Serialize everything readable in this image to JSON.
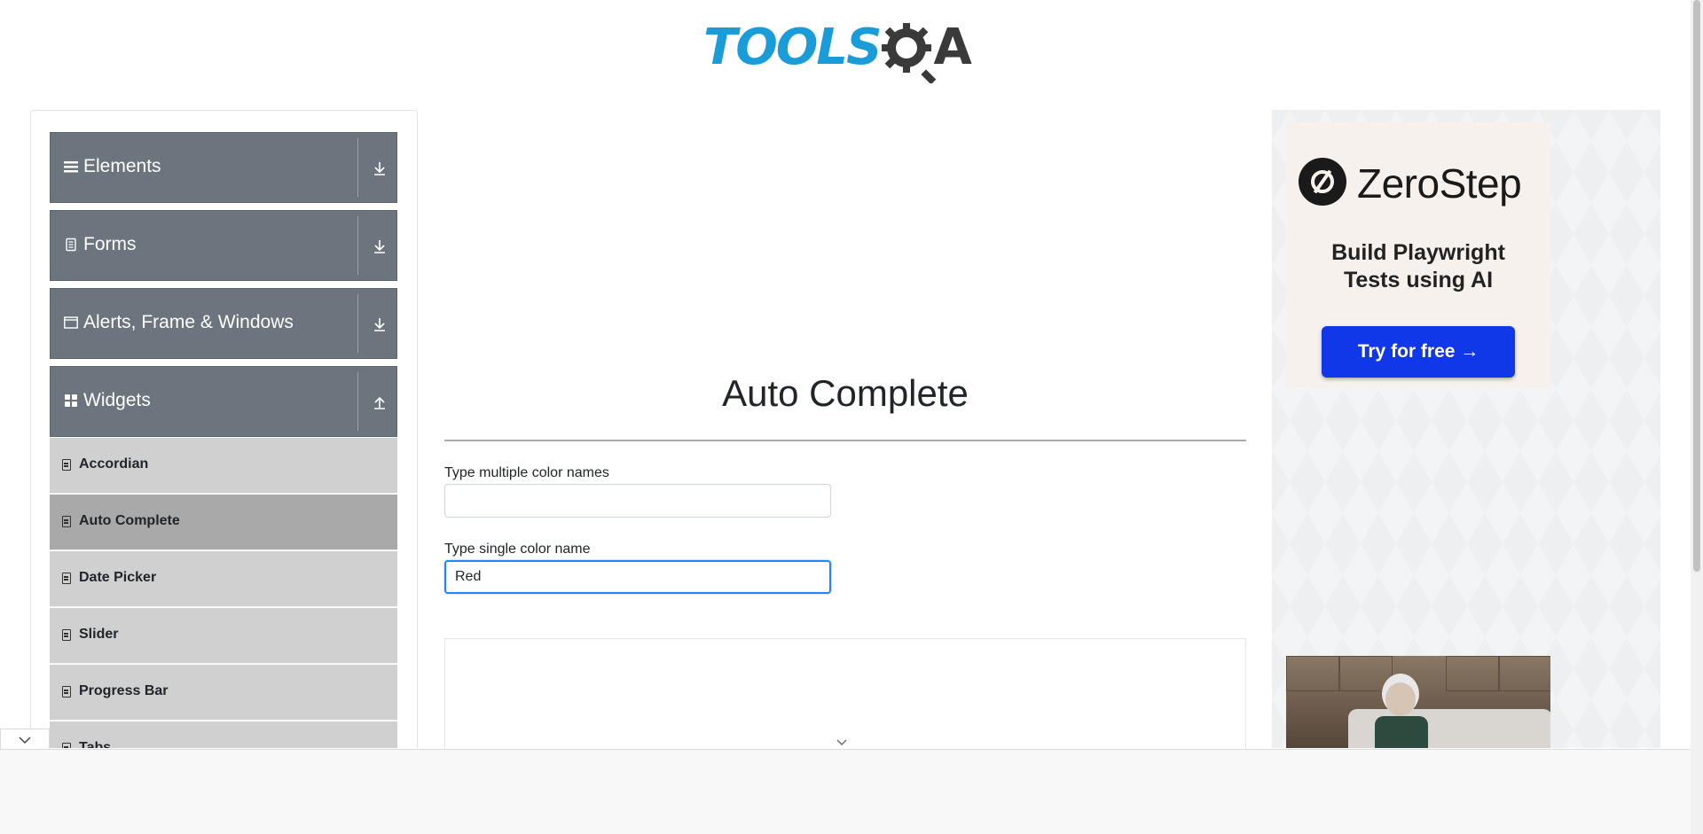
{
  "logo": {
    "tools": "TOOLS",
    "a": "A",
    "colors": {
      "tools": "#1a9cd8",
      "gear": "#3a3a3a"
    }
  },
  "sidebar": {
    "groups": [
      {
        "label": "Elements",
        "icon": "hamburger-icon",
        "arrow": "download-icon"
      },
      {
        "label": "Forms",
        "icon": "document-icon",
        "arrow": "download-icon"
      },
      {
        "label": "Alerts, Frame & Windows",
        "icon": "window-icon",
        "arrow": "download-icon"
      },
      {
        "label": "Widgets",
        "icon": "grid-icon",
        "arrow": "upload-icon"
      }
    ],
    "items": [
      {
        "label": "Accordian",
        "active": false
      },
      {
        "label": "Auto Complete",
        "active": true
      },
      {
        "label": "Date Picker",
        "active": false
      },
      {
        "label": "Slider",
        "active": false
      },
      {
        "label": "Progress Bar",
        "active": false
      },
      {
        "label": "Tabs",
        "active": false
      }
    ]
  },
  "main": {
    "title": "Auto Complete",
    "multi": {
      "label": "Type multiple color names",
      "value": ""
    },
    "single": {
      "label": "Type single color name",
      "value": "Red"
    }
  },
  "ad": {
    "brand": "ZeroStep",
    "tagline_line1": "Build Playwright",
    "tagline_line2": "Tests using AI",
    "cta": "Try for free →",
    "cta_color": "#1037e8"
  }
}
